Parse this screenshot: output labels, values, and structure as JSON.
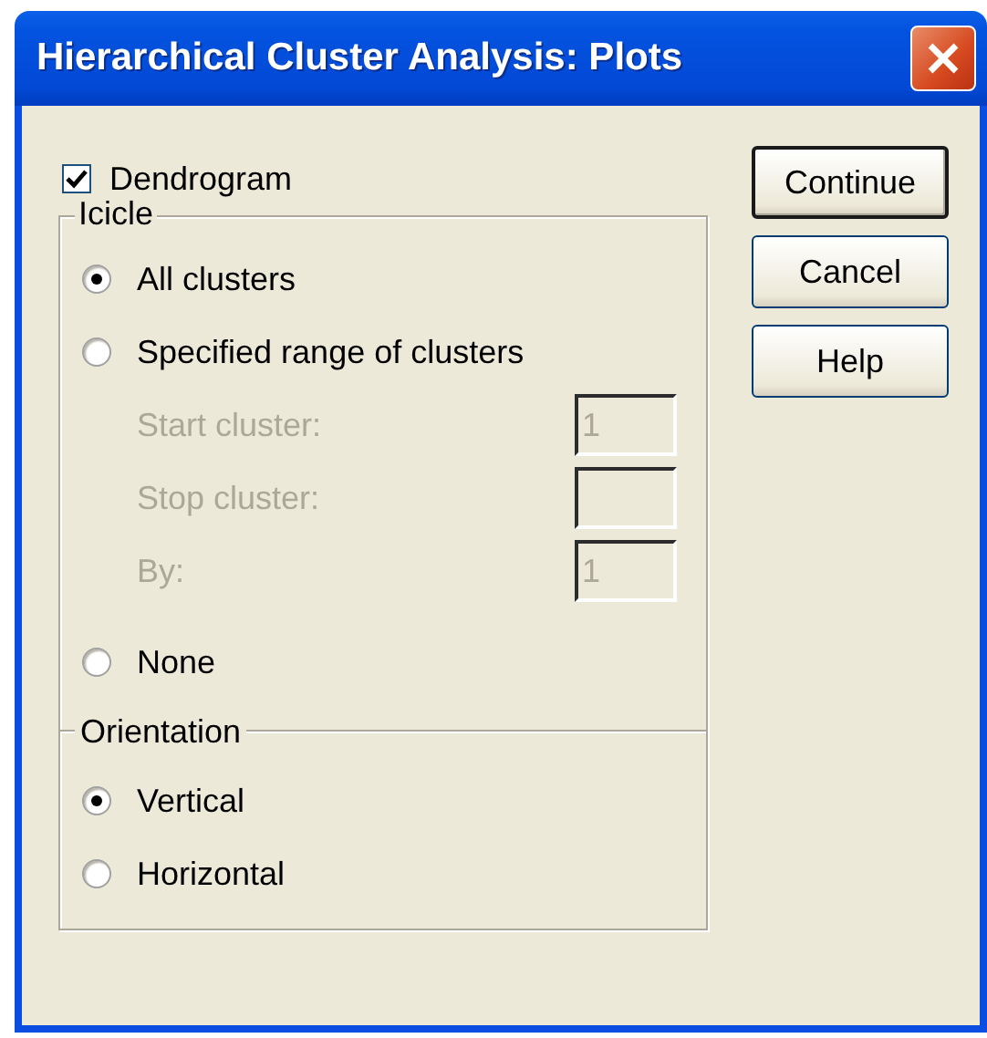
{
  "window": {
    "title": "Hierarchical Cluster Analysis: Plots"
  },
  "dendrogram": {
    "label": "Dendrogram",
    "checked": true
  },
  "icicle": {
    "title": "Icicle",
    "options": [
      {
        "label": "All clusters",
        "selected": true
      },
      {
        "label": "Specified range of clusters",
        "selected": false,
        "fields": [
          {
            "label": "Start cluster:",
            "value": "1",
            "disabled": true
          },
          {
            "label": "Stop cluster:",
            "disabled": true
          },
          {
            "label": "By:",
            "value": "1",
            "disabled": true
          }
        ]
      },
      {
        "label": "None",
        "selected": false
      }
    ]
  },
  "orientation": {
    "title": "Orientation",
    "options": [
      {
        "label": "Vertical",
        "selected": true
      },
      {
        "label": "Horizontal",
        "selected": false
      }
    ]
  },
  "buttons": [
    {
      "label": "Continue",
      "default": true
    },
    {
      "label": "Cancel",
      "default": false
    },
    {
      "label": "Help",
      "default": false
    }
  ]
}
